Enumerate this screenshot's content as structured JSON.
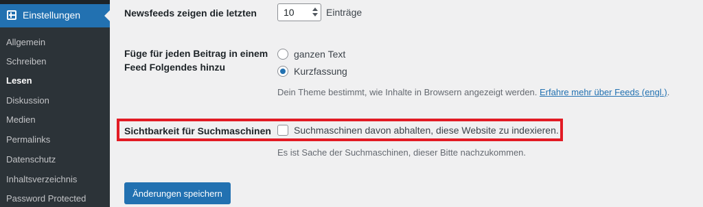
{
  "sidebar": {
    "active_menu": {
      "label": "Einstellungen",
      "icon": "settings-icon"
    },
    "items": [
      {
        "label": "Allgemein"
      },
      {
        "label": "Schreiben"
      },
      {
        "label": "Lesen"
      },
      {
        "label": "Diskussion"
      },
      {
        "label": "Medien"
      },
      {
        "label": "Permalinks"
      },
      {
        "label": "Datenschutz"
      },
      {
        "label": "Inhaltsverzeichnis"
      },
      {
        "label": "Password Protected"
      }
    ],
    "current_item": "Lesen"
  },
  "settings": {
    "feed_count": {
      "label": "Newsfeeds zeigen die letzten",
      "value": "10",
      "unit": "Einträge"
    },
    "feed_content": {
      "label_line1": "Füge für jeden Beitrag in einem",
      "label_line2": "Feed Folgendes hinzu",
      "options": [
        {
          "label": "ganzen Text",
          "checked": false
        },
        {
          "label": "Kurzfassung",
          "checked": true
        }
      ],
      "description": "Dein Theme bestimmt, wie Inhalte in Browsern angezeigt werden.",
      "link_text": "Erfahre mehr über Feeds (engl.)",
      "link_suffix": "."
    },
    "search_visibility": {
      "label": "Sichtbarkeit für Suchmaschinen",
      "checkbox_label": "Suchmaschinen davon abhalten, diese Website zu indexieren.",
      "checked": false,
      "description": "Es ist Sache der Suchmaschinen, dieser Bitte nachzukommen."
    }
  },
  "save_button": {
    "label": "Änderungen speichern"
  },
  "colors": {
    "accent": "#2271b1",
    "sidebar_bg": "#1d2327",
    "submenu_bg": "#2c3338",
    "highlight": "#e21b24",
    "page_bg": "#f0f0f1"
  }
}
